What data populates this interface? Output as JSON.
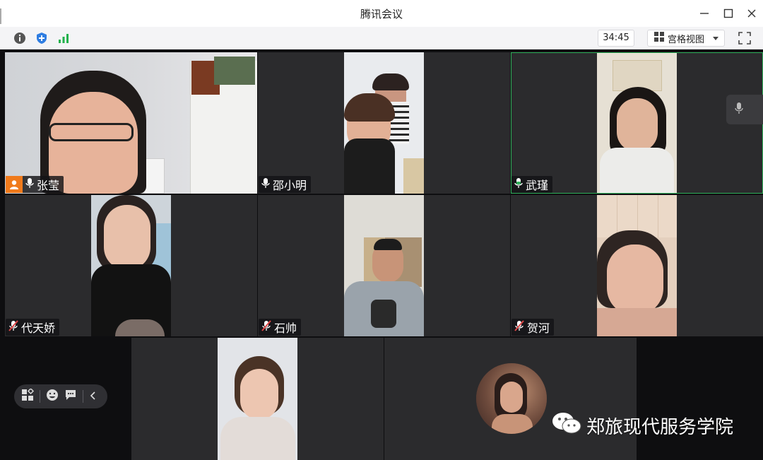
{
  "window": {
    "title": "腾讯会议"
  },
  "toolbar": {
    "timer": "34:45",
    "view_label": "宫格视图",
    "icons": [
      "info-icon",
      "shield-icon",
      "signal-icon",
      "grid-icon",
      "fullscreen-icon"
    ]
  },
  "participants": [
    {
      "name": "张莹",
      "mic": "on",
      "host": true
    },
    {
      "name": "邵小明",
      "mic": "on",
      "host": false
    },
    {
      "name": "武瑾",
      "mic": "on",
      "host": false,
      "speaking": true
    },
    {
      "name": "代天娇",
      "mic": "muted",
      "host": false
    },
    {
      "name": "石帅",
      "mic": "muted",
      "host": false
    },
    {
      "name": "贺河",
      "mic": "muted",
      "host": false
    }
  ],
  "watermark": {
    "text": "郑旅现代服务学院"
  },
  "colors": {
    "host_badge": "#f07a1b",
    "active_speaker_border": "#2fb05a",
    "tile_bg": "#2b2b2d",
    "muted_icon": "#e04646"
  }
}
